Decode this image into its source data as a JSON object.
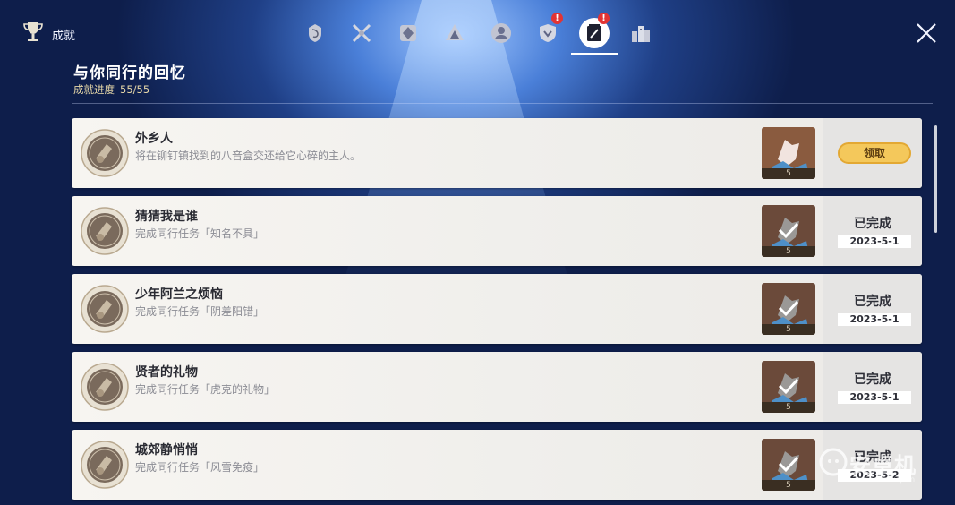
{
  "header": {
    "brand_label": "成就",
    "tabs": [
      {
        "icon": "anemo-emblem-icon",
        "active": false,
        "alert": false
      },
      {
        "icon": "crossed-swords-icon",
        "active": false,
        "alert": false
      },
      {
        "icon": "diamond-sigil-icon",
        "active": false,
        "alert": false
      },
      {
        "icon": "mountain-triangle-icon",
        "active": false,
        "alert": false
      },
      {
        "icon": "character-bust-icon",
        "active": false,
        "alert": false
      },
      {
        "icon": "shield-crest-icon",
        "active": false,
        "alert": true
      },
      {
        "icon": "memory-book-icon",
        "active": true,
        "alert": true
      },
      {
        "icon": "city-skyline-icon",
        "active": false,
        "alert": false
      }
    ],
    "alert_glyph": "!"
  },
  "category": {
    "title": "与你同行的回忆",
    "progress_label": "成就进度",
    "progress_value": "55/55"
  },
  "achievements": [
    {
      "title": "外乡人",
      "desc": "将在铆钉镇找到的八音盒交还给它心碎的主人。",
      "reward_count": "5",
      "state": "claim",
      "claim_label": "领取",
      "done_label": "",
      "date": ""
    },
    {
      "title": "猜猜我是谁",
      "desc": "完成同行任务「知名不具」",
      "reward_count": "5",
      "state": "done",
      "claim_label": "",
      "done_label": "已完成",
      "date": "2023-5-1"
    },
    {
      "title": "少年阿兰之烦恼",
      "desc": "完成同行任务「阴差阳错」",
      "reward_count": "5",
      "state": "done",
      "claim_label": "",
      "done_label": "已完成",
      "date": "2023-5-1"
    },
    {
      "title": "贤者的礼物",
      "desc": "完成同行任务「虎克的礼物」",
      "reward_count": "5",
      "state": "done",
      "claim_label": "",
      "done_label": "已完成",
      "date": "2023-5-1"
    },
    {
      "title": "城郊静悄悄",
      "desc": "完成同行任务「风雪免疫」",
      "reward_count": "5",
      "state": "done",
      "claim_label": "",
      "done_label": "已完成",
      "date": "2023-5-2"
    }
  ],
  "watermark": {
    "text": "安卓机",
    "url": "www.anzhuoji.cn"
  },
  "colors": {
    "claim_button": "#f4c85b",
    "progress_text": "#e7d8a9",
    "alert": "#e23434"
  }
}
